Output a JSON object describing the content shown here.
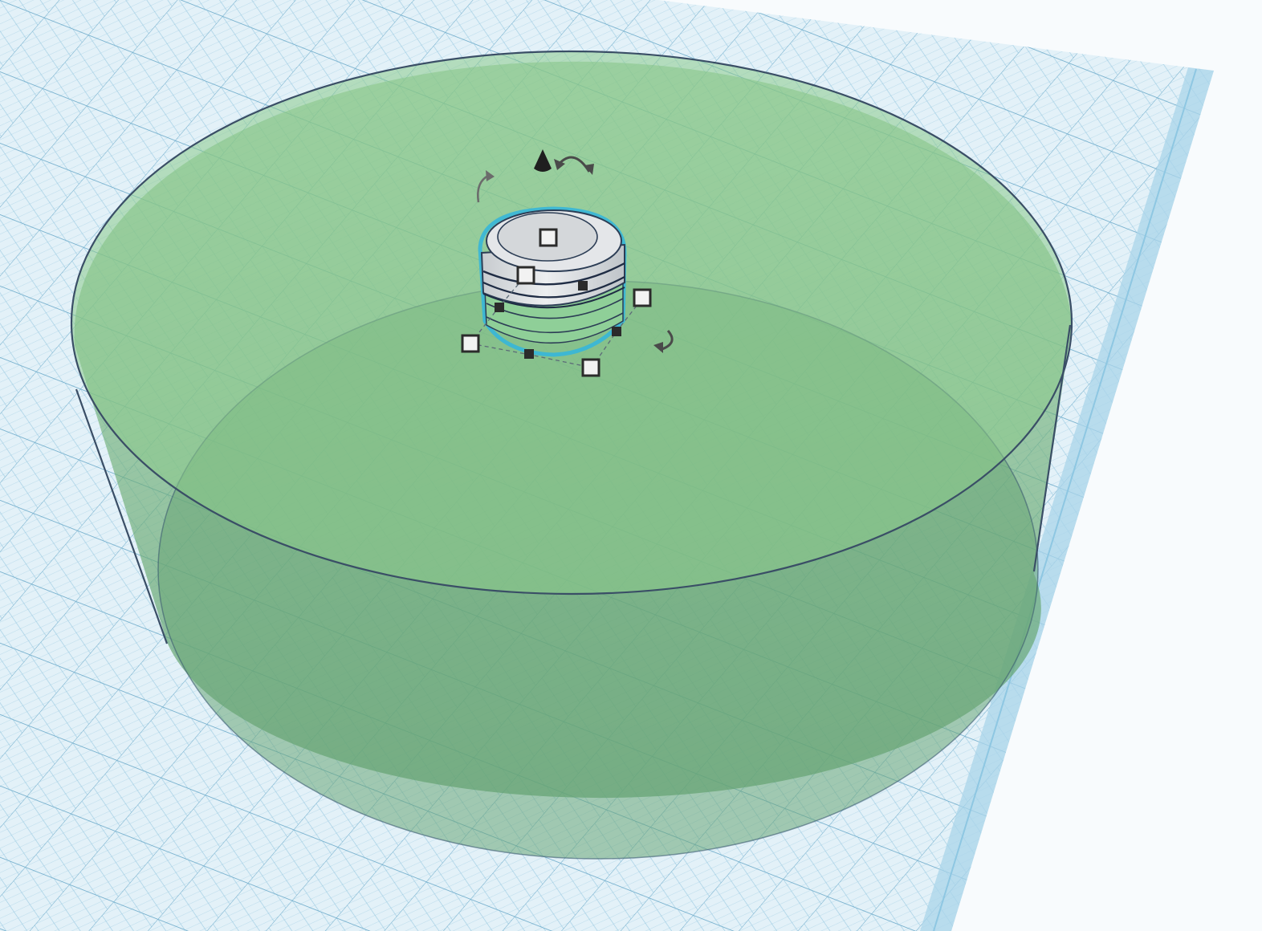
{
  "app": {
    "view": "3d-workplane",
    "selection_count": 1
  },
  "workplane": {
    "color": "#cfe6f2",
    "grid_color": "#7fbbd6",
    "edge_color": "#a9d4ea"
  },
  "shapes": [
    {
      "name": "cylinder",
      "kind": "solid",
      "color": "#7fbf7f",
      "opacity": "translucent"
    },
    {
      "name": "threaded-bolt",
      "kind": "selected-shape",
      "color": "#d9dcdf",
      "outline_color": "#36b6d9"
    }
  ],
  "gizmo": {
    "icons": [
      "lift-cone-icon",
      "rotate-arrow-icon"
    ],
    "handle_colors": {
      "white": "#f2f2f2",
      "black": "#2b2b2b"
    }
  }
}
